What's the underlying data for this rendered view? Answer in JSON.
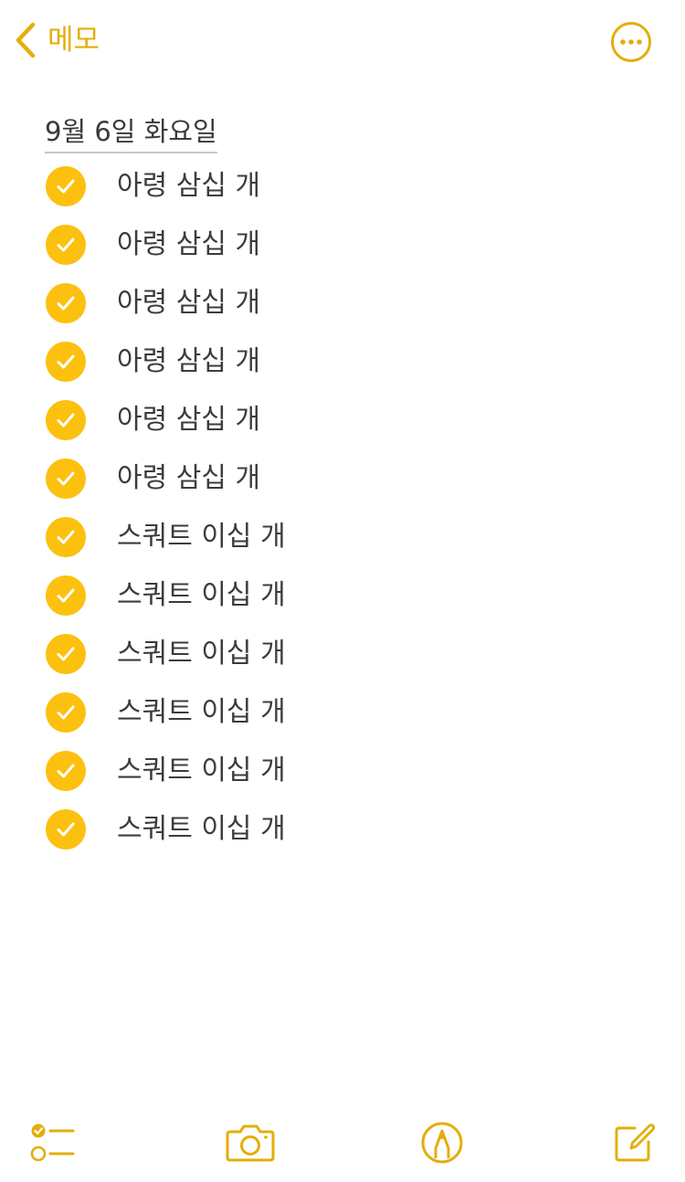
{
  "header": {
    "back_label": "메모",
    "back_icon": "chevron-left-icon",
    "more_icon": "ellipsis-circle-icon"
  },
  "note": {
    "title": "9월 6일 화요일",
    "items": [
      {
        "text": "아령 삼십 개",
        "checked": true
      },
      {
        "text": "아령 삼십 개",
        "checked": true
      },
      {
        "text": "아령 삼십 개",
        "checked": true
      },
      {
        "text": "아령 삼십 개",
        "checked": true
      },
      {
        "text": "아령 삼십 개",
        "checked": true
      },
      {
        "text": "아령 삼십 개",
        "checked": true
      },
      {
        "text": "스쿼트 이십 개",
        "checked": true
      },
      {
        "text": "스쿼트 이십 개",
        "checked": true
      },
      {
        "text": "스쿼트 이십 개",
        "checked": true
      },
      {
        "text": "스쿼트 이십 개",
        "checked": true
      },
      {
        "text": "스쿼트 이십 개",
        "checked": true
      },
      {
        "text": "스쿼트 이십 개",
        "checked": true
      }
    ]
  },
  "toolbar": {
    "icons": [
      "checklist-icon",
      "camera-icon",
      "markup-pen-icon",
      "compose-icon"
    ]
  },
  "colors": {
    "accent": "#e4ae0a",
    "check_fill": "#fcc00f",
    "text": "#3a3a3c",
    "background": "#ffffff"
  }
}
